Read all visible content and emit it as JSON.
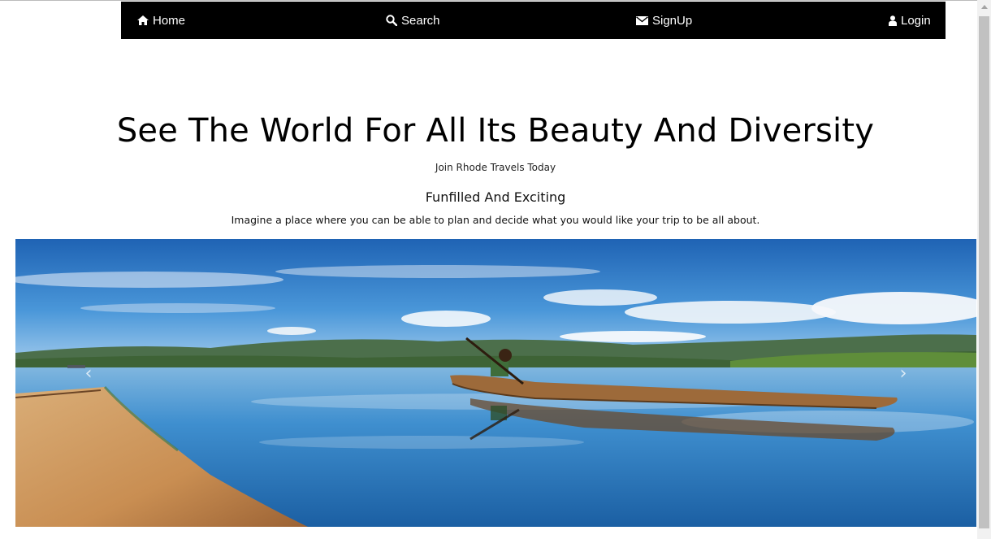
{
  "nav": {
    "home": {
      "label": "Home",
      "icon": "home-icon"
    },
    "search": {
      "label": "Search",
      "icon": "search-icon"
    },
    "signup": {
      "label": "SignUp",
      "icon": "envelope-icon"
    },
    "login": {
      "label": "Login",
      "icon": "user-icon"
    }
  },
  "hero": {
    "title": "See The World For All Its Beauty And Diversity",
    "tagline": "Join Rhode Travels Today",
    "subtitle": "Funfilled And Exciting",
    "text": "Imagine a place where you can be able to plan and decide what you would like your trip to be all about."
  },
  "carousel": {
    "prev_glyph": "‹",
    "next_glyph": "›"
  },
  "colors": {
    "nav_bg": "#000000",
    "nav_text": "#ffffff",
    "sky": "#2f7fc8",
    "water": "#3b8fc9"
  }
}
